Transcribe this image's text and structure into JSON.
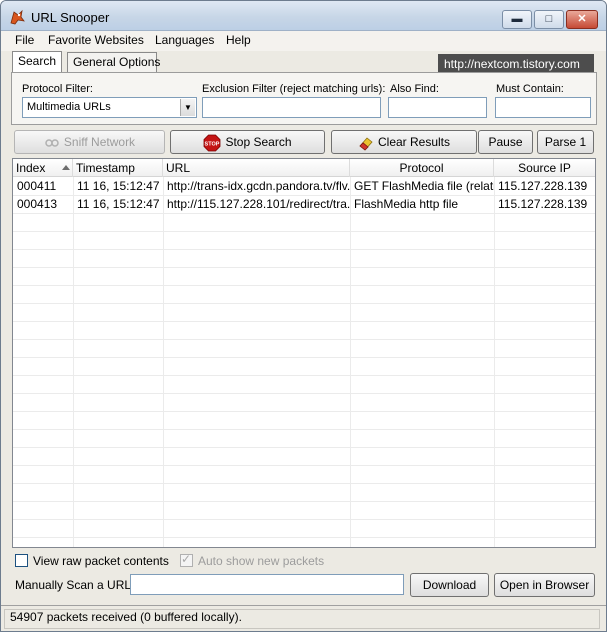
{
  "window": {
    "title": "URL Snooper",
    "buttons": {
      "minimize": "▬",
      "maximize": "□",
      "close": "✕"
    }
  },
  "menu": [
    "File",
    "Favorite Websites",
    "Languages",
    "Help"
  ],
  "tabs": {
    "search": "Search",
    "general": "General Options"
  },
  "banner": "http://nextcom.tistory.com",
  "filters": {
    "protocol_label": "Protocol Filter:",
    "protocol_value": "Multimedia URLs",
    "exclusion_label": "Exclusion Filter (reject matching urls):",
    "exclusion_value": "",
    "also_find_label": "Also Find:",
    "also_find_value": "",
    "must_contain_label": "Must Contain:",
    "must_contain_value": ""
  },
  "toolbar": {
    "sniff": "Sniff Network",
    "stop": "Stop Search",
    "stop_icon": "STOP",
    "clear": "Clear Results",
    "pause": "Pause",
    "parse": "Parse 1"
  },
  "table": {
    "columns": [
      "Index",
      "Timestamp",
      "URL",
      "Protocol",
      "Source IP"
    ],
    "rows": [
      [
        "000411",
        "11 16, 15:12:47",
        "http://trans-idx.gcdn.pandora.tv/flv...",
        "GET FlashMedia file (relative)",
        "115.127.228.139"
      ],
      [
        "000413",
        "11 16, 15:12:47",
        "http://115.127.228.101/redirect/tra...",
        "FlashMedia http file",
        "115.127.228.139"
      ]
    ]
  },
  "options": {
    "raw_packets": "View raw packet contents",
    "auto_show": "Auto show new packets"
  },
  "manual": {
    "label": "Manually Scan a URL:",
    "value": "",
    "download": "Download",
    "open_browser": "Open in Browser"
  },
  "status": "54907 packets received (0 buffered locally)."
}
